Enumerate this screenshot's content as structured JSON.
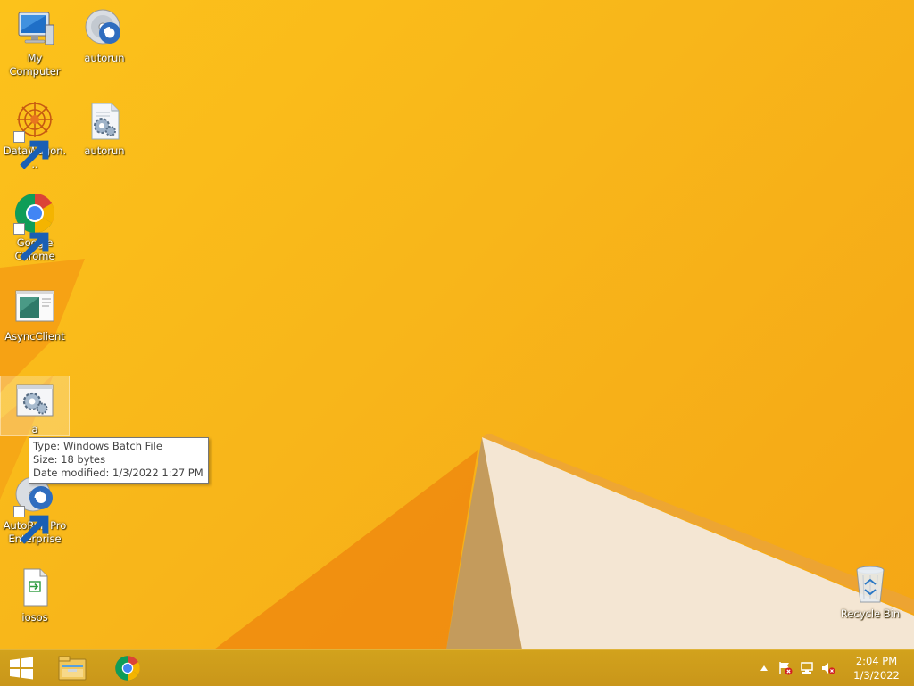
{
  "desktop_icons": [
    {
      "label": "My Computer"
    },
    {
      "label": "autorun"
    },
    {
      "label": "DataWagon..."
    },
    {
      "label": "autorun"
    },
    {
      "label": "Google Chrome"
    },
    {
      "label": "AsyncClient"
    },
    {
      "label": "a"
    },
    {
      "label": "AutoRun Pro Enterprise"
    },
    {
      "label": "iosos"
    },
    {
      "label": "Recycle Bin"
    }
  ],
  "tooltip": {
    "type": "Type: Windows Batch File",
    "size": "Size: 18 bytes",
    "modified": "Date modified: 1/3/2022 1:27 PM"
  },
  "taskbar": {
    "pinned": [
      "start-icon",
      "file-explorer-icon",
      "chrome-icon"
    ],
    "tray_icons": [
      "show-hidden-icons",
      "action-center-flag-icon",
      "network-icon",
      "volume-muted-icon"
    ],
    "clock": {
      "time": "2:04 PM",
      "date": "1/3/2022"
    }
  },
  "colors": {
    "wallpaper": "#f8b61a",
    "taskbar": "#c9961a",
    "accent_light": "#f3e4d0"
  }
}
